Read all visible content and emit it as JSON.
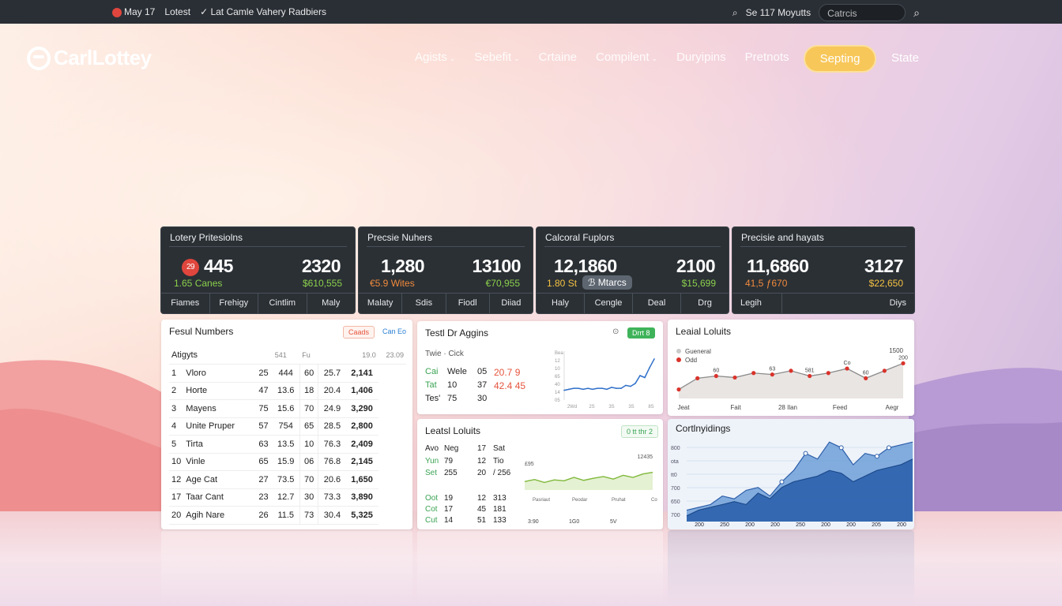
{
  "topbar": {
    "badge": "May 17",
    "latest": "Lotest",
    "check_msg": "✓ Lat Camle Vahery Radbiers",
    "right_text": "Se 117 Moyutts",
    "search_value": "Catrcis"
  },
  "logo": {
    "text": "CarlLottey"
  },
  "nav": {
    "items": [
      {
        "label": "Agists",
        "dropdown": true
      },
      {
        "label": "Sebefit",
        "dropdown": true
      },
      {
        "label": "Crtaine",
        "dropdown": false
      },
      {
        "label": "Compilent",
        "dropdown": true
      },
      {
        "label": "Duryipins",
        "dropdown": false
      },
      {
        "label": "Pretnots",
        "dropdown": false
      }
    ],
    "cta": "Septing",
    "last": "State"
  },
  "stats": [
    {
      "title": "Lotery Pritesiolns",
      "badge": "29",
      "big1": "445",
      "big2": "2320",
      "sub1": "1.65 Canes",
      "sub2": "$610,555",
      "footer": [
        "Fiames",
        "Frehigy",
        "Cintlim",
        "Maly"
      ]
    },
    {
      "title": "Precsie Nuhers",
      "big1": "1,280",
      "big2": "13100",
      "sub1": "€5.9 Wites",
      "sub2": "€70,955",
      "footer": [
        "Malaty",
        "Sdis",
        "Fiodl",
        "Diiad"
      ]
    },
    {
      "title": "Calcoral Fuplors",
      "big1": "12,1860",
      "big2": "2100",
      "sub1": "1.80 St",
      "pill": "ℬ Mtarcs",
      "sub2": "$15,699",
      "footer": [
        "Haly",
        "Cengle",
        "Deal",
        "Drg"
      ]
    },
    {
      "title": "Precisie and hayats",
      "big1": "11,6860",
      "big2": "3127",
      "sub1": "41,5 ƒ670",
      "sub2": "$22,650",
      "footer": [
        "Legih",
        "",
        "",
        "Diys"
      ]
    }
  ],
  "numbers_panel": {
    "title": "Fesul Numbers",
    "chip1": "Caads",
    "chip2": "Can Eo",
    "header": [
      "Atigyts",
      "",
      "541",
      "Fu",
      "",
      "19.0",
      "23.09"
    ],
    "rows": [
      [
        "1",
        "Vloro",
        "25",
        "444",
        "60",
        "25.7",
        "2,141"
      ],
      [
        "2",
        "Horte",
        "47",
        "13.6",
        "18",
        "20.4",
        "1,406"
      ],
      [
        "3",
        "Mayens",
        "75",
        "15.6",
        "70",
        "24.9",
        "3,290"
      ],
      [
        "4",
        "Unite Pruper",
        "57",
        "754",
        "65",
        "28.5",
        "2,800"
      ],
      [
        "5",
        "Tirta",
        "63",
        "13.5",
        "10",
        "76.3",
        "2,409"
      ],
      [
        "10",
        "Vinle",
        "65",
        "15.9",
        "06",
        "76.8",
        "2,145"
      ],
      [
        "12",
        "Age Cat",
        "27",
        "73.5",
        "70",
        "20.6",
        "1,650"
      ],
      [
        "17",
        "Taar Cant",
        "23",
        "12.7",
        "30",
        "73.3",
        "3,890"
      ],
      [
        "20",
        "Agih Nare",
        "26",
        "11.5",
        "73",
        "30.4",
        "5,325"
      ]
    ]
  },
  "test_panel": {
    "title": "Testl Dr Aggins",
    "chip": "Drrt 8",
    "subhead": "Twie · Cick",
    "rows": [
      [
        "Cai",
        "Wele",
        "05",
        "20.7 9"
      ],
      [
        "Tat",
        "10",
        "37",
        "42.4 45"
      ],
      [
        "Tes'",
        "75",
        "30",
        ""
      ]
    ],
    "yticks": [
      "Bea",
      "12",
      "10",
      "65",
      "40",
      "14",
      "05"
    ],
    "xticks": [
      "2Wd",
      "2S",
      "3S",
      "3S",
      "8S"
    ],
    "chart_data": {
      "type": "line",
      "x": [
        1,
        2,
        3,
        4,
        5,
        6,
        7,
        8,
        9,
        10,
        11,
        12,
        13,
        14,
        15,
        16,
        17,
        18,
        19,
        20
      ],
      "series": [
        {
          "values": [
            40,
            41,
            42,
            42,
            41,
            42,
            41,
            42,
            42,
            41,
            43,
            42,
            42,
            45,
            44,
            47,
            55,
            53,
            63,
            72
          ]
        }
      ]
    }
  },
  "lower_mid_panel": {
    "title": "Leatsl Loluits",
    "chip": "0 tt thr 2",
    "header": [
      "Avo",
      "Neg",
      "",
      "17",
      "Sat"
    ],
    "top_rows": [
      [
        "Yun",
        "79",
        "",
        "12",
        "Tio"
      ],
      [
        "Set",
        "255",
        "",
        "20",
        "/ 256"
      ]
    ],
    "bottom_rows": [
      [
        "Oot",
        "19",
        "",
        "12",
        "313"
      ],
      [
        "Cot",
        "17",
        "",
        "45",
        "181"
      ],
      [
        "Cut",
        "14",
        "",
        "51",
        "133"
      ]
    ],
    "legend": [
      "£95",
      "12435"
    ],
    "xticks": [
      "3:90",
      "1G0",
      "5V"
    ],
    "xlabels": [
      "Pasriaut",
      "Peodar",
      "Pruhat",
      "Cot"
    ],
    "chart_data": {
      "type": "area",
      "x": [
        1,
        2,
        3,
        4,
        5,
        6,
        7,
        8,
        9,
        10,
        11,
        12,
        13,
        14
      ],
      "series": [
        {
          "values": [
            40,
            45,
            38,
            44,
            42,
            50,
            43,
            48,
            52,
            46,
            55,
            50,
            58,
            62
          ]
        }
      ]
    }
  },
  "right_top_panel": {
    "title": "Leaial Loluits",
    "legend": [
      {
        "label": "Gueneral",
        "color": "#c9c9c9"
      },
      {
        "label": "Odd",
        "color": "#d9332b"
      }
    ],
    "top_right": "1500",
    "point_labels": [
      "60",
      "63",
      "581",
      "Co",
      "60",
      "200"
    ],
    "xticks": [
      "Jeat",
      "Fait",
      "28 Ilan",
      "Feed",
      "Aegr"
    ],
    "chart_data": {
      "type": "line",
      "x": [
        1,
        2,
        3,
        4,
        5,
        6,
        7,
        8,
        9,
        10,
        11,
        12,
        13
      ],
      "series": [
        {
          "name": "Gueneral",
          "values": [
            30,
            45,
            48,
            46,
            52,
            50,
            55,
            48,
            52,
            58,
            45,
            55,
            65
          ]
        }
      ]
    }
  },
  "right_bottom_panel": {
    "title": "Cortlnyidings",
    "yticks": [
      "800",
      "ota",
      "tt0",
      "700",
      "650",
      "700"
    ],
    "xticks": [
      "200",
      "250",
      "200",
      "200",
      "250",
      "200",
      "200",
      "205",
      "200"
    ],
    "chart_data": {
      "type": "area",
      "x": [
        1,
        2,
        3,
        4,
        5,
        6,
        7,
        8,
        9,
        10,
        11,
        12,
        13,
        14,
        15,
        16,
        17,
        18,
        19,
        20
      ],
      "series": [
        {
          "values": [
            20,
            25,
            30,
            45,
            40,
            55,
            60,
            45,
            70,
            90,
            120,
            110,
            140,
            130,
            100,
            120,
            115,
            130,
            135,
            140
          ]
        },
        {
          "values": [
            10,
            20,
            25,
            30,
            35,
            30,
            50,
            40,
            60,
            70,
            75,
            80,
            90,
            85,
            70,
            80,
            90,
            95,
            100,
            110
          ]
        }
      ]
    }
  }
}
